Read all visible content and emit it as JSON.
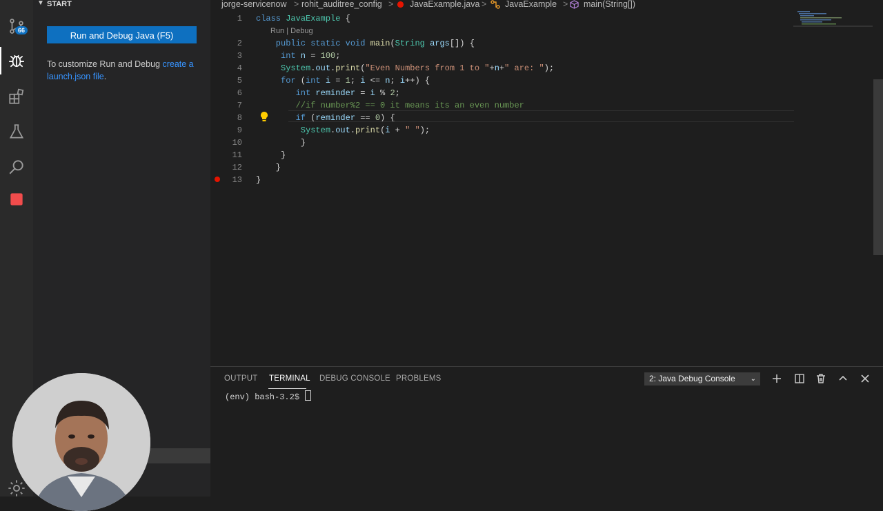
{
  "sidebar": {
    "header": "START",
    "run_button": "Run and Debug Java (F5)",
    "customize_prefix": "To customize Run and Debug ",
    "customize_link": "create a launch.json file",
    "customize_suffix": "."
  },
  "activity_bar": {
    "scm_badge": "66",
    "icons": [
      "source-control-icon",
      "run-debug-icon",
      "extensions-icon",
      "testing-icon",
      "search-icon",
      "stop-icon",
      "gear-icon"
    ]
  },
  "breadcrumb": {
    "items": [
      "jorge-servicenow",
      "rohit_auditree_config",
      "JavaExample.java",
      "JavaExample",
      "main(String[])"
    ],
    "separator": ">"
  },
  "editor": {
    "codelens": "Run | Debug",
    "line_numbers": [
      "1",
      "2",
      "3",
      "4",
      "5",
      "6",
      "7",
      "8",
      "9",
      "10",
      "11",
      "12",
      "13"
    ],
    "lines": [
      {
        "p": [
          [
            "kw",
            "class "
          ],
          [
            "ty",
            "JavaExample"
          ],
          [
            "op",
            " {"
          ]
        ]
      },
      {
        "p": [
          [
            "kw",
            "    public static void "
          ],
          [
            "fn",
            "main"
          ],
          [
            "op",
            "("
          ],
          [
            "ty",
            "String"
          ],
          [
            "var",
            " args"
          ],
          [
            "op",
            "[]) {"
          ]
        ]
      },
      {
        "p": [
          [
            "kw",
            "     int"
          ],
          [
            "var",
            " n"
          ],
          [
            "op",
            " = "
          ],
          [
            "num",
            "100"
          ],
          [
            "op",
            ";"
          ]
        ]
      },
      {
        "p": [
          [
            "ty",
            "     System"
          ],
          [
            "op",
            "."
          ],
          [
            "var",
            "out"
          ],
          [
            "op",
            "."
          ],
          [
            "fn",
            "print"
          ],
          [
            "op",
            "("
          ],
          [
            "str",
            "\"Even Numbers from 1 to \""
          ],
          [
            "op",
            "+"
          ],
          [
            "var",
            "n"
          ],
          [
            "op",
            "+"
          ],
          [
            "str",
            "\" are: \""
          ],
          [
            "op",
            ");"
          ]
        ]
      },
      {
        "p": [
          [
            "kw",
            "     for"
          ],
          [
            "op",
            " ("
          ],
          [
            "kw",
            "int"
          ],
          [
            "var",
            " i"
          ],
          [
            "op",
            " = "
          ],
          [
            "num",
            "1"
          ],
          [
            "op",
            "; "
          ],
          [
            "var",
            "i"
          ],
          [
            "op",
            " <= "
          ],
          [
            "var",
            "n"
          ],
          [
            "op",
            "; "
          ],
          [
            "var",
            "i"
          ],
          [
            "op",
            "++) {"
          ]
        ]
      },
      {
        "p": [
          [
            "kw",
            "        int"
          ],
          [
            "var",
            " reminder"
          ],
          [
            "op",
            " = "
          ],
          [
            "var",
            "i"
          ],
          [
            "op",
            " % "
          ],
          [
            "num",
            "2"
          ],
          [
            "op",
            ";"
          ]
        ]
      },
      {
        "p": [
          [
            "cm",
            "        //if number%2 == 0 it means its an even number"
          ]
        ]
      },
      {
        "p": [
          [
            "kw",
            "        if"
          ],
          [
            "op",
            " ("
          ],
          [
            "var",
            "reminder"
          ],
          [
            "op",
            " == "
          ],
          [
            "num",
            "0"
          ],
          [
            "op",
            ") {"
          ]
        ]
      },
      {
        "p": [
          [
            "ty",
            "         System"
          ],
          [
            "op",
            "."
          ],
          [
            "var",
            "out"
          ],
          [
            "op",
            "."
          ],
          [
            "fn",
            "print"
          ],
          [
            "op",
            "("
          ],
          [
            "var",
            "i"
          ],
          [
            "op",
            " + "
          ],
          [
            "str",
            "\" \""
          ],
          [
            "op",
            ");"
          ]
        ]
      },
      {
        "p": [
          [
            "op",
            "         }"
          ]
        ]
      },
      {
        "p": [
          [
            "op",
            "     }"
          ]
        ]
      },
      {
        "p": [
          [
            "op",
            "    }"
          ]
        ]
      },
      {
        "p": [
          [
            "op",
            "}"
          ]
        ]
      }
    ]
  },
  "panel": {
    "tabs": [
      "OUTPUT",
      "TERMINAL",
      "DEBUG CONSOLE",
      "PROBLEMS"
    ],
    "active_tab": "TERMINAL",
    "terminal_select": "2: Java Debug Console",
    "prompt": "(env) bash-3.2$ "
  },
  "colors": {
    "accent": "#0e70c0",
    "breakpoint": "#e51400",
    "link": "#3794ff"
  }
}
